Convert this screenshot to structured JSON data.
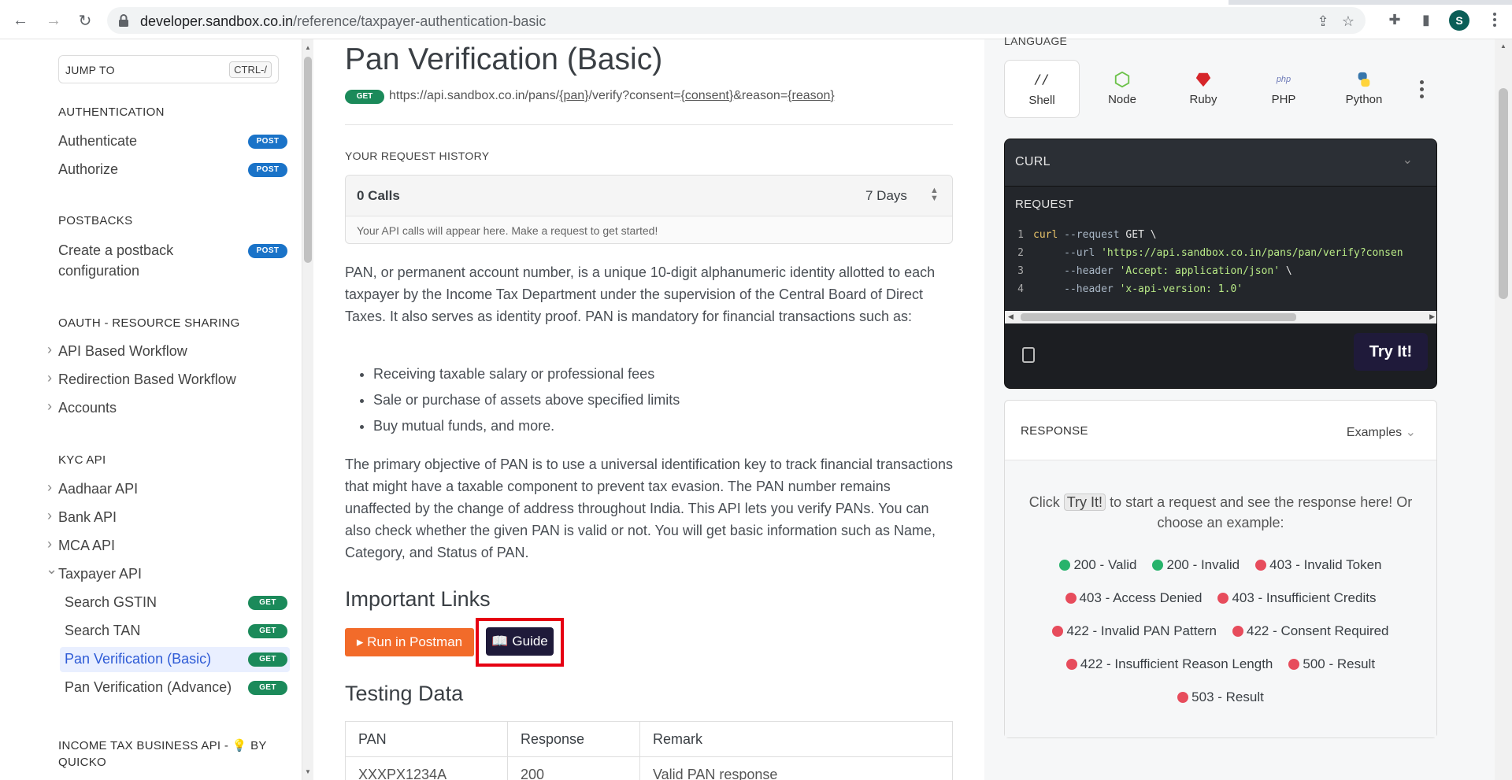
{
  "browser": {
    "url_host": "developer.sandbox.co.in",
    "url_path": "/reference/taxpayer-authentication-basic",
    "avatar_initial": "S"
  },
  "sidebar": {
    "jump_label": "JUMP TO",
    "jump_shortcut": "CTRL-/",
    "sections": {
      "authentication": "AUTHENTICATION",
      "postbacks": "POSTBACKS",
      "oauth": "OAUTH - RESOURCE SHARING",
      "kyc": "KYC API",
      "income_tax_line1": "INCOME TAX BUSINESS API - 💡 BY",
      "income_tax_line2": "QUICKO"
    },
    "items": {
      "authenticate": "Authenticate",
      "authorize": "Authorize",
      "create_postback_1": "Create a postback",
      "create_postback_2": "configuration",
      "api_workflow": "API Based Workflow",
      "redirection_workflow": "Redirection Based Workflow",
      "accounts": "Accounts",
      "aadhaar": "Aadhaar API",
      "bank": "Bank API",
      "mca": "MCA API",
      "taxpayer": "Taxpayer API",
      "search_gstin": "Search GSTIN",
      "search_tan": "Search TAN",
      "pan_basic": "Pan Verification (Basic)",
      "pan_advance": "Pan Verification (Advance)"
    },
    "badges": {
      "post": "POST",
      "get": "GET"
    }
  },
  "main": {
    "title": "Pan Verification (Basic)",
    "method": "GET",
    "endpoint": {
      "a": "https://api.sandbox.co.in/pans/",
      "b": "{pan}",
      "c": "/verify?consent=",
      "d": "{consent}",
      "e": "&reason=",
      "f": "{reason}"
    },
    "history_label": "YOUR REQUEST HISTORY",
    "calls": "0 Calls",
    "days": "7 Days",
    "history_hint": "Your API calls will appear here. Make a request to get started!",
    "para1": "PAN, or permanent account number, is a unique 10-digit alphanumeric identity allotted to each taxpayer by the Income Tax Department under the supervision of the Central Board of Direct Taxes. It also serves as identity proof. PAN is mandatory for financial transactions such as:",
    "bullets": [
      "Receiving taxable salary or professional fees",
      "Sale or purchase of assets above specified limits",
      "Buy mutual funds, and more."
    ],
    "para2": "The primary objective of PAN is to use a universal identification key to track financial transactions that might have a taxable component to prevent tax evasion. The PAN number remains unaffected by the change of address throughout India. This API lets you verify PANs. You can also check whether the given PAN is valid or not. You will get basic information such as Name, Category, and Status of PAN.",
    "important_links": "Important Links",
    "postman_btn": "▸ Run in Postman",
    "guide_btn": "Guide",
    "testing_data": "Testing Data",
    "table": {
      "headers": [
        "PAN",
        "Response",
        "Remark"
      ],
      "row1": [
        "XXXPX1234A",
        "200",
        "Valid PAN response"
      ]
    }
  },
  "right": {
    "language_label": "LANGUAGE",
    "languages": [
      "Shell",
      "Node",
      "Ruby",
      "PHP",
      "Python"
    ],
    "curl_label": "CURL",
    "request_label": "REQUEST",
    "code": {
      "l1_cmd": "curl",
      "l1_flag": " --request",
      "l1_rest": " GET \\",
      "l2_flag": "     --url",
      "l2_str": " 'https://api.sandbox.co.in/pans/pan/verify?consen",
      "l3_flag": "     --header",
      "l3_str": " 'Accept: application/json'",
      "l3_end": " \\",
      "l4_flag": "     --header",
      "l4_str": " 'x-api-version: 1.0'"
    },
    "try_btn": "Try It!",
    "response_label": "RESPONSE",
    "examples_label": "Examples",
    "resp_text_a": "Click",
    "resp_text_kbd": "Try It!",
    "resp_text_b": "to start a request and see the response here! Or choose an example:",
    "examples": [
      {
        "label": "200 - Valid",
        "ok": true
      },
      {
        "label": "200 - Invalid",
        "ok": true
      },
      {
        "label": "403 - Invalid Token",
        "ok": false
      },
      {
        "label": "403 - Access Denied",
        "ok": false
      },
      {
        "label": "403 - Insufficient Credits",
        "ok": false
      },
      {
        "label": "422 - Invalid PAN Pattern",
        "ok": false
      },
      {
        "label": "422 - Consent Required",
        "ok": false
      },
      {
        "label": "422 - Insufficient Reason Length",
        "ok": false
      },
      {
        "label": "500 - Result",
        "ok": false
      },
      {
        "label": "503 - Result",
        "ok": false
      }
    ]
  }
}
